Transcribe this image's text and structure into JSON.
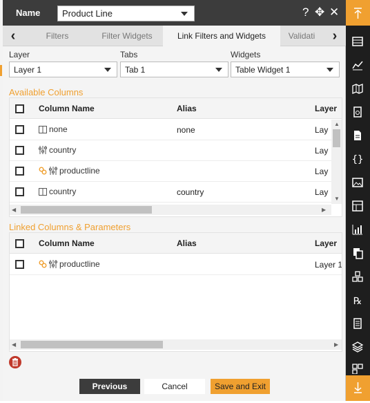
{
  "header": {
    "name_label": "Name",
    "name_value": "Product Line",
    "help_icon": "?",
    "move_icon": "✥",
    "close_icon": "✕"
  },
  "tabs": {
    "items": [
      {
        "label": "Filters",
        "active": false
      },
      {
        "label": "Filter Widgets",
        "active": false
      },
      {
        "label": "Link Filters and Widgets",
        "active": true
      },
      {
        "label": "Validati",
        "active": false
      }
    ],
    "prev_icon": "‹",
    "next_icon": "›"
  },
  "selectors": {
    "layer_label": "Layer",
    "layer_value": "Layer 1",
    "tabs_label": "Tabs",
    "tabs_value": "Tab 1",
    "widgets_label": "Widgets",
    "widgets_value": "Table Widget 1"
  },
  "available": {
    "title": "Available Columns",
    "headers": {
      "column_name": "Column Name",
      "alias": "Alias",
      "layer": "Layer"
    },
    "rows": [
      {
        "icons": [
          "column-icon"
        ],
        "name": "none",
        "alias": "none",
        "layer": "Lay"
      },
      {
        "icons": [
          "filter-sliders-icon"
        ],
        "name": "country",
        "alias": "",
        "layer": "Lay"
      },
      {
        "icons": [
          "link-icon",
          "filter-sliders-icon"
        ],
        "name": "productline",
        "alias": "",
        "layer": "Lay"
      },
      {
        "icons": [
          "column-icon"
        ],
        "name": "country",
        "alias": "country",
        "layer": "Lay"
      }
    ]
  },
  "linked": {
    "title": "Linked Columns & Parameters",
    "headers": {
      "column_name": "Column Name",
      "alias": "Alias",
      "layer": "Layer"
    },
    "rows": [
      {
        "icons": [
          "link-icon",
          "filter-sliders-icon"
        ],
        "name": "productline",
        "alias": "",
        "layer": "Layer 1"
      }
    ]
  },
  "footer": {
    "previous": "Previous",
    "cancel": "Cancel",
    "save_exit": "Save and Exit"
  },
  "rightbar": {
    "icons": [
      "table-icon",
      "chart-icon",
      "map-icon",
      "report-icon",
      "document-icon",
      "code-icon",
      "image-icon",
      "widget-icon",
      "bar-chart-icon",
      "copy-icon",
      "boxes-icon",
      "rx-icon",
      "notes-icon",
      "layers-icon",
      "grid-icon"
    ]
  },
  "colors": {
    "accent": "#f0a030",
    "dark": "#3c3c3c",
    "danger": "#c0392b"
  }
}
